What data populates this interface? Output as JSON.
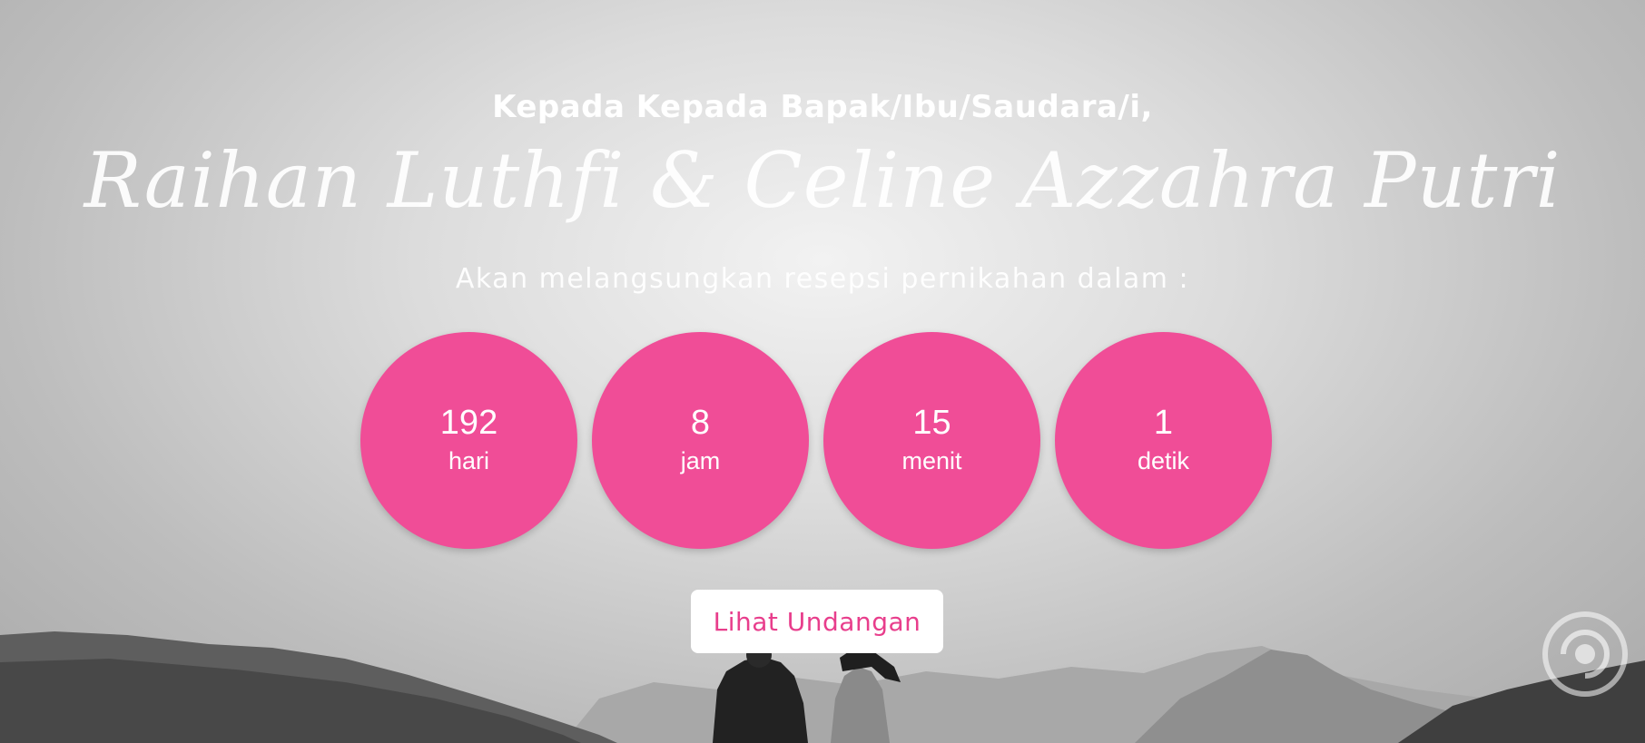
{
  "hero": {
    "greeting": "Kepada Kepada Bapak/Ibu/Saudara/i,",
    "couple_names": "Raihan Luthfi & Celine Azzahra Putri",
    "subtitle": "Akan melangsungkan resepsi pernikahan dalam :"
  },
  "countdown": [
    {
      "value": "192",
      "unit": "hari"
    },
    {
      "value": "8",
      "unit": "jam"
    },
    {
      "value": "15",
      "unit": "menit"
    },
    {
      "value": "1",
      "unit": "detik"
    }
  ],
  "cta": {
    "label": "Lihat Undangan"
  },
  "music_toggle": {
    "icon": "music-disc-icon"
  },
  "colors": {
    "accent": "#f04d97",
    "button_text": "#e83e8c"
  }
}
